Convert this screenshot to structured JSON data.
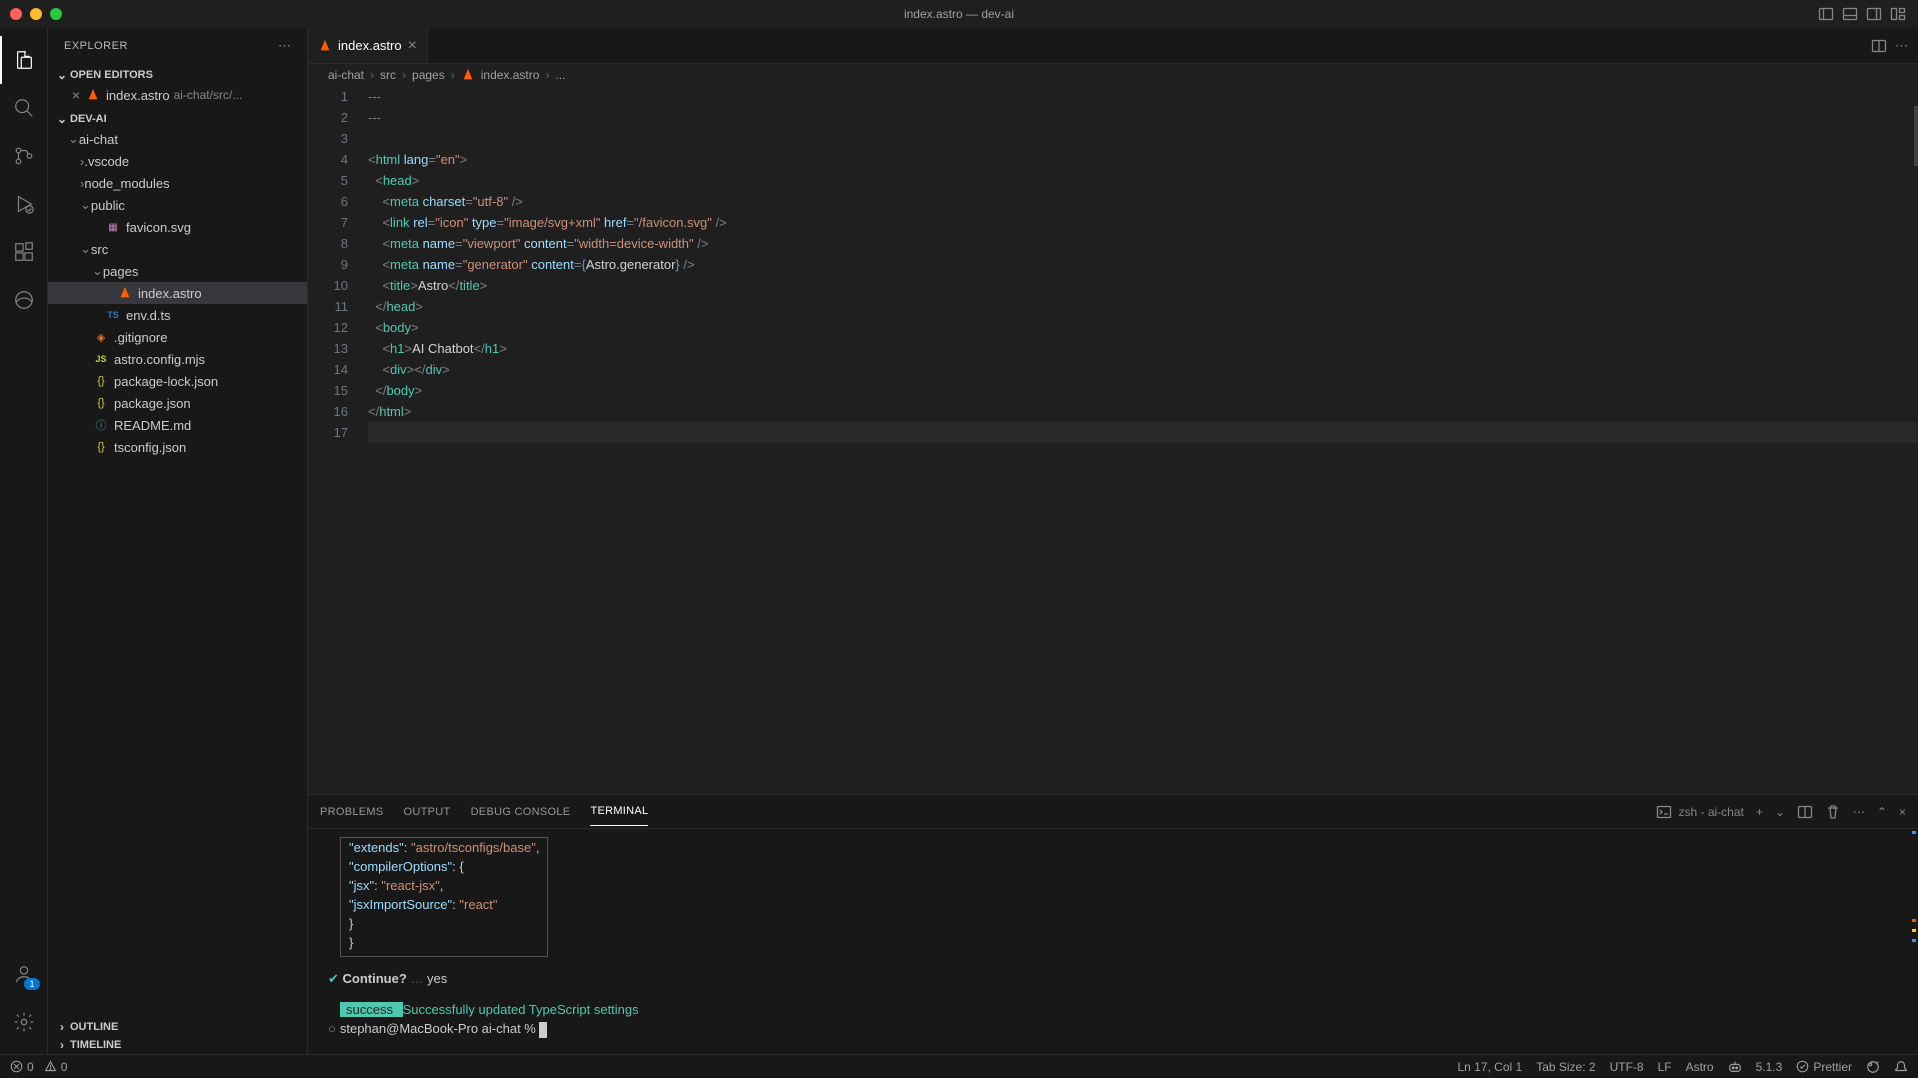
{
  "window": {
    "title": "index.astro — dev-ai"
  },
  "sidebar": {
    "title": "EXPLORER",
    "sections": {
      "open_editors": "OPEN EDITORS",
      "workspace": "DEV-AI",
      "outline": "OUTLINE",
      "timeline": "TIMELINE"
    },
    "open_editor": {
      "name": "index.astro",
      "hint": "ai-chat/src/..."
    },
    "tree": [
      {
        "label": "ai-chat",
        "depth": 1,
        "kind": "folder-open"
      },
      {
        "label": ".vscode",
        "depth": 2,
        "kind": "folder"
      },
      {
        "label": "node_modules",
        "depth": 2,
        "kind": "folder"
      },
      {
        "label": "public",
        "depth": 2,
        "kind": "folder-open"
      },
      {
        "label": "favicon.svg",
        "depth": 3,
        "kind": "svg"
      },
      {
        "label": "src",
        "depth": 2,
        "kind": "folder-open"
      },
      {
        "label": "pages",
        "depth": 3,
        "kind": "folder-open"
      },
      {
        "label": "index.astro",
        "depth": 4,
        "kind": "astro",
        "selected": true
      },
      {
        "label": "env.d.ts",
        "depth": 3,
        "kind": "ts"
      },
      {
        "label": ".gitignore",
        "depth": 2,
        "kind": "git"
      },
      {
        "label": "astro.config.mjs",
        "depth": 2,
        "kind": "js"
      },
      {
        "label": "package-lock.json",
        "depth": 2,
        "kind": "json"
      },
      {
        "label": "package.json",
        "depth": 2,
        "kind": "json"
      },
      {
        "label": "README.md",
        "depth": 2,
        "kind": "md"
      },
      {
        "label": "tsconfig.json",
        "depth": 2,
        "kind": "json"
      }
    ]
  },
  "tabs": {
    "active": "index.astro"
  },
  "breadcrumbs": [
    "ai-chat",
    "src",
    "pages",
    "index.astro",
    "..."
  ],
  "editor": {
    "lines": [
      {
        "n": 1,
        "html": "<span class='tok-punct'>---</span>"
      },
      {
        "n": 2,
        "html": "<span class='tok-punct'>---</span>"
      },
      {
        "n": 3,
        "html": ""
      },
      {
        "n": 4,
        "html": "<span class='tok-punct'>&lt;</span><span class='tok-tag'>html</span> <span class='tok-attr'>lang</span><span class='tok-punct'>=</span><span class='tok-str'>\"en\"</span><span class='tok-punct'>&gt;</span>"
      },
      {
        "n": 5,
        "html": "  <span class='tok-punct'>&lt;</span><span class='tok-tag'>head</span><span class='tok-punct'>&gt;</span>"
      },
      {
        "n": 6,
        "html": "    <span class='tok-punct'>&lt;</span><span class='tok-tag'>meta</span> <span class='tok-attr'>charset</span><span class='tok-punct'>=</span><span class='tok-str'>\"utf-8\"</span> <span class='tok-punct'>/&gt;</span>"
      },
      {
        "n": 7,
        "html": "    <span class='tok-punct'>&lt;</span><span class='tok-tag'>link</span> <span class='tok-attr'>rel</span><span class='tok-punct'>=</span><span class='tok-str'>\"icon\"</span> <span class='tok-attr'>type</span><span class='tok-punct'>=</span><span class='tok-str'>\"image/svg+xml\"</span> <span class='tok-attr'>href</span><span class='tok-punct'>=</span><span class='tok-str'>\"/favicon.svg\"</span> <span class='tok-punct'>/&gt;</span>"
      },
      {
        "n": 8,
        "html": "    <span class='tok-punct'>&lt;</span><span class='tok-tag'>meta</span> <span class='tok-attr'>name</span><span class='tok-punct'>=</span><span class='tok-str'>\"viewport\"</span> <span class='tok-attr'>content</span><span class='tok-punct'>=</span><span class='tok-str'>\"width=device-width\"</span> <span class='tok-punct'>/&gt;</span>"
      },
      {
        "n": 9,
        "html": "    <span class='tok-punct'>&lt;</span><span class='tok-tag'>meta</span> <span class='tok-attr'>name</span><span class='tok-punct'>=</span><span class='tok-str'>\"generator\"</span> <span class='tok-attr'>content</span><span class='tok-punct'>=</span><span class='tok-brace'>{</span><span class='tok-text'>Astro.generator</span><span class='tok-brace'>}</span> <span class='tok-punct'>/&gt;</span>"
      },
      {
        "n": 10,
        "html": "    <span class='tok-punct'>&lt;</span><span class='tok-tag'>title</span><span class='tok-punct'>&gt;</span><span class='tok-text'>Astro</span><span class='tok-punct'>&lt;/</span><span class='tok-tag'>title</span><span class='tok-punct'>&gt;</span>"
      },
      {
        "n": 11,
        "html": "  <span class='tok-punct'>&lt;/</span><span class='tok-tag'>head</span><span class='tok-punct'>&gt;</span>"
      },
      {
        "n": 12,
        "html": "  <span class='tok-punct'>&lt;</span><span class='tok-tag'>body</span><span class='tok-punct'>&gt;</span>"
      },
      {
        "n": 13,
        "html": "    <span class='tok-punct'>&lt;</span><span class='tok-tag'>h1</span><span class='tok-punct'>&gt;</span><span class='tok-text'>AI Chatbot</span><span class='tok-punct'>&lt;/</span><span class='tok-tag'>h1</span><span class='tok-punct'>&gt;</span>"
      },
      {
        "n": 14,
        "html": "    <span class='tok-punct'>&lt;</span><span class='tok-tag'>div</span><span class='tok-punct'>&gt;&lt;/</span><span class='tok-tag'>div</span><span class='tok-punct'>&gt;</span>"
      },
      {
        "n": 15,
        "html": "  <span class='tok-punct'>&lt;/</span><span class='tok-tag'>body</span><span class='tok-punct'>&gt;</span>"
      },
      {
        "n": 16,
        "html": "<span class='tok-punct'>&lt;/</span><span class='tok-tag'>html</span><span class='tok-punct'>&gt;</span>"
      },
      {
        "n": 17,
        "html": "",
        "current": true
      }
    ]
  },
  "panel": {
    "tabs": {
      "problems": "PROBLEMS",
      "output": "OUTPUT",
      "debug": "DEBUG CONSOLE",
      "terminal": "TERMINAL"
    },
    "terminal_label": "zsh - ai-chat",
    "terminal": {
      "box_lines": [
        "  <span class='term-key'>\"extends\"</span>: <span class='term-str'>\"astro/tsconfigs/base\"</span>,",
        "  <span class='term-key'>\"compilerOptions\"</span>: {",
        "    <span class='term-key'>\"jsx\"</span>: <span class='term-str'>\"react-jsx\"</span>,",
        "    <span class='term-key'>\"jsxImportSource\"</span>: <span class='term-str'>\"react\"</span>",
        "  }",
        "}"
      ],
      "continue_prompt": "Continue?",
      "continue_answer": "yes",
      "success_label": " success ",
      "success_msg": "Successfully updated TypeScript settings",
      "prompt": "stephan@MacBook-Pro ai-chat % "
    }
  },
  "status": {
    "errors": "0",
    "warnings": "0",
    "cursor": "Ln 17, Col 1",
    "tab_size": "Tab Size: 2",
    "encoding": "UTF-8",
    "eol": "LF",
    "lang": "Astro",
    "version": "5.1.3",
    "prettier": "Prettier"
  },
  "accounts_badge": "1"
}
